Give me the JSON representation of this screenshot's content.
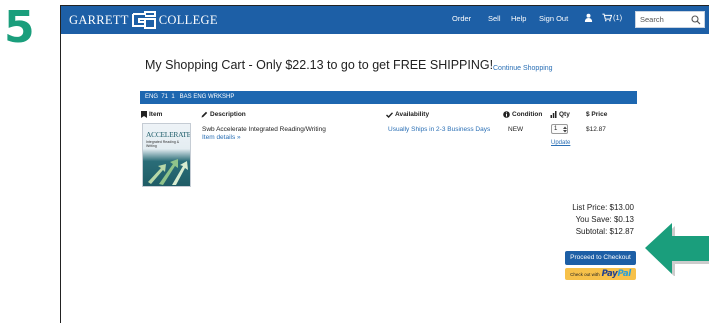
{
  "step": {
    "number": "5"
  },
  "header": {
    "logo_left": "GARRETT",
    "logo_right": "COLLEGE",
    "nav": {
      "order": "Order",
      "sell": "Sell",
      "help": "Help",
      "sign_out": "Sign Out",
      "cart": "(1)"
    },
    "search": {
      "placeholder": "Search"
    }
  },
  "cart": {
    "title": "My Shopping Cart - Only $22.13 to go to get FREE SHIPPING!",
    "continue_label": "Continue Shopping",
    "course_label": "ENG  71  1   BAS ENG WRKSHP",
    "columns": {
      "item": "Item",
      "description": "Description",
      "availability": "Availability",
      "condition": "Condition",
      "qty": "Qty",
      "price": "$ Price"
    },
    "item": {
      "cover_title": "ACCELERATE:",
      "cover_subtitle": "Integrated Reading & Writing",
      "title": "Swb Accelerate Integrated Reading/Writing",
      "details_link": "Item details »",
      "availability": "Usually Ships in 2-3 Business Days",
      "condition": "NEW",
      "qty": "1",
      "update_label": "Update",
      "price": "$12.87"
    },
    "totals": {
      "list_price": "List Price: $13.00",
      "you_save": "You Save: $0.13",
      "subtotal": "Subtotal: $12.87"
    },
    "checkout_label": "Proceed to Checkout",
    "paypal": {
      "prefix": "Check out with",
      "logo_a": "Pay",
      "logo_b": "Pal"
    }
  },
  "colors": {
    "header_blue": "#1d5fa6",
    "link_blue": "#2a6fb5",
    "arrow_teal": "#1a9e7c",
    "paypal_yellow": "#f7c14a"
  }
}
